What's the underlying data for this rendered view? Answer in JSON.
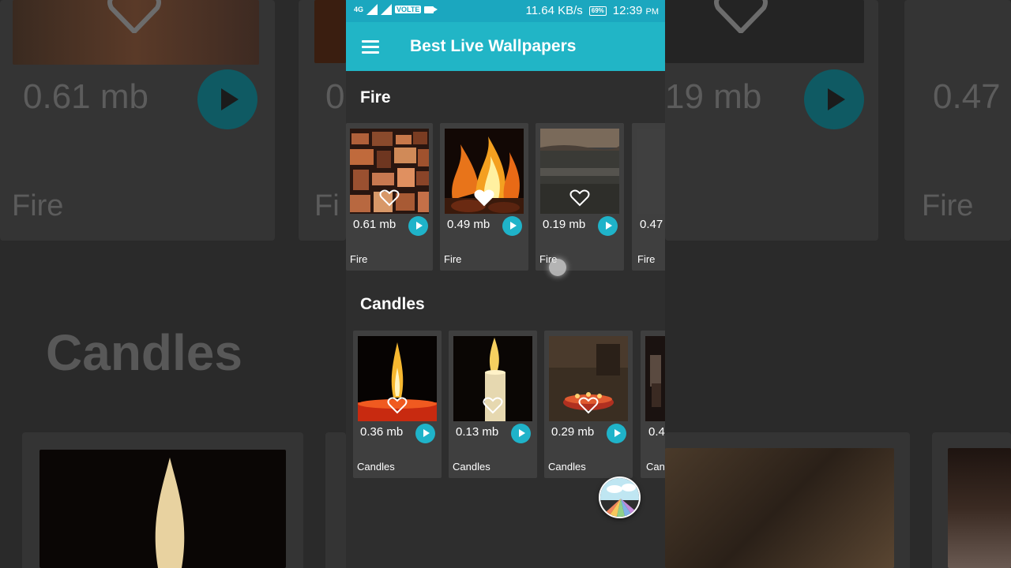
{
  "status_bar": {
    "network_label": "4G",
    "volte_label": "VOLTE",
    "speed": "11.64 KB/s",
    "battery": "69%",
    "time": "12:39",
    "ampm": "PM"
  },
  "app_bar": {
    "title": "Best Live Wallpapers",
    "menu_icon": "hamburger-menu-icon"
  },
  "sections": [
    {
      "title": "Fire",
      "items": [
        {
          "size": "0.61 mb",
          "category": "Fire"
        },
        {
          "size": "0.49 mb",
          "category": "Fire"
        },
        {
          "size": "0.19 mb",
          "category": "Fire"
        },
        {
          "size": "0.47",
          "category": "Fire"
        }
      ]
    },
    {
      "title": "Candles",
      "items": [
        {
          "size": "0.36 mb",
          "category": "Candles"
        },
        {
          "size": "0.13 mb",
          "category": "Candles"
        },
        {
          "size": "0.29 mb",
          "category": "Candles"
        },
        {
          "size": "0.4",
          "category": "Can"
        }
      ]
    }
  ],
  "background": {
    "sizes": [
      "0.61 mb",
      "0",
      "19 mb",
      "0.47"
    ],
    "fire_labels": [
      "Fire",
      "Fi",
      "Fire"
    ],
    "candles_label": "Candles"
  },
  "colors": {
    "accent": "#21b5c6",
    "status_bar": "#1ba7bf",
    "play_button": "#1fb3c9",
    "surface": "#2e2e2e",
    "card": "#3f3f3f"
  }
}
